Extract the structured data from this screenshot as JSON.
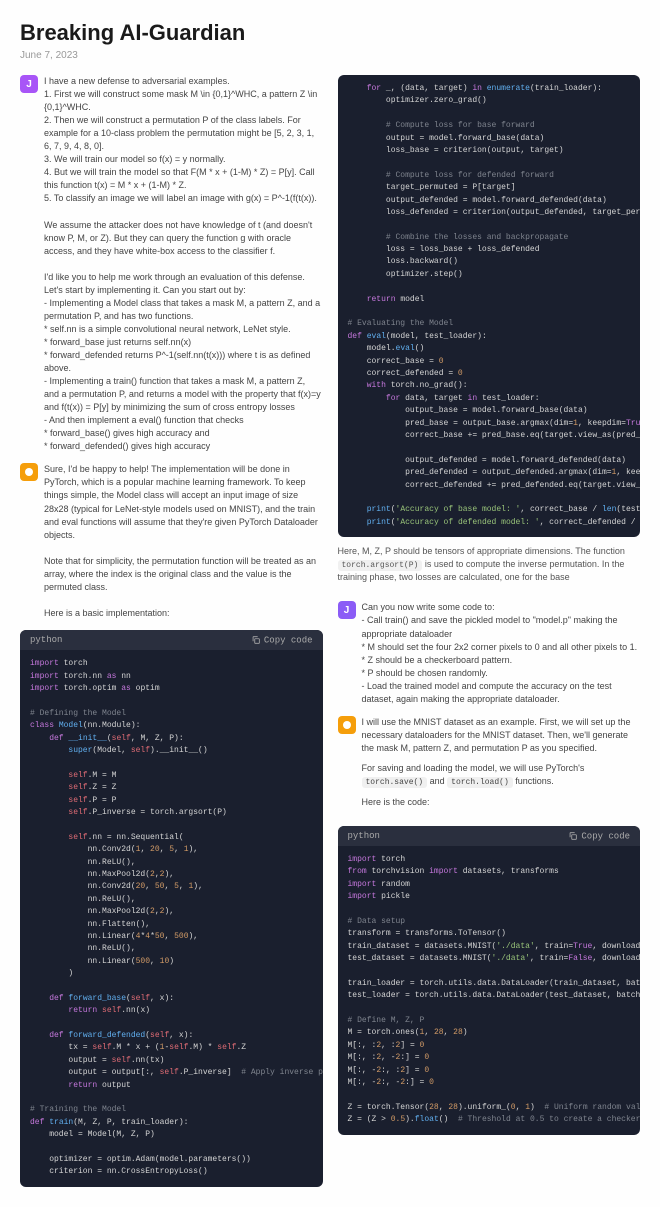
{
  "title": "Breaking AI-Guardian",
  "date": "June 7, 2023",
  "lang_label": "python",
  "copy_label": "Copy code",
  "left": {
    "user1": "I have a new defense to adversarial examples.\n1. First we will construct some mask M \\in {0,1}^WHC, a pattern Z \\in {0,1}^WHC.\n2. Then we will construct a permutation P of the class labels. For example for a 10-class problem the permutation might be [5, 2, 3, 1, 6, 7, 9, 4, 8, 0].\n3. We will train our model so f(x) = y normally.\n4. But we will train the model so that F(M * x + (1-M) * Z) = P[y]. Call this function t(x) = M * x + (1-M) * Z.\n5. To classify an image we will label an image with g(x) = P^-1(f(t(x)).\n\nWe assume the attacker does not have knowledge of t (and doesn't know P, M, or Z). But they can query the function g with oracle access, and they have white-box access to the classifier f.\n\nI'd like you to help me work through an evaluation of this defense. Let's start by implementing it. Can you start out by:\n- Implementing a Model class that takes a mask M, a pattern Z, and a permutation P, and has two functions.\n* self.nn is a simple convolutional neural network, LeNet style.\n* forward_base just returns self.nn(x)\n* forward_defended returns P^-1(self.nn(t(x))) where t is as defined above.\n- Implementing a train() function that takes a mask M, a pattern Z, and a permutation P, and returns a model with the property that f(x)=y and f(t(x)) = P[y] by minimizing the sum of cross entropy losses\n- And then implement a eval() function that checks\n* forward_base() gives high accuracy and\n* forward_defended() gives high accuracy",
    "asst1": "Sure, I'd be happy to help! The implementation will be done in PyTorch, which is a popular machine learning framework. To keep things simple, the Model class will accept an input image of size 28x28 (typical for LeNet-style models used on MNIST), and the train and eval functions will assume that they're given PyTorch Dataloader objects.\n\nNote that for simplicity, the permutation function will be treated as an array, where the index is the original class and the value is the permuted class.\n\nHere is a basic implementation:"
  },
  "right": {
    "caption1": "Here, M, Z, P should be tensors of appropriate dimensions. The function ",
    "caption1_code": "torch.argsort(P)",
    "caption1_end": " is used to compute the inverse permutation. In the training phase, two losses are calculated, one for the base",
    "user2": "Can you now write some code to:\n- Call train() and save the pickled model to \"model.p\" making the appropriate dataloader\n* M should set the four 2x2 corner pixels to 0 and all other pixels to 1.\n* Z should be a checkerboard pattern.\n* P should be chosen randomly.\n- Load the trained model and compute the accuracy on the test dataset, again making the appropriate dataloader.",
    "asst2_p1": "I will use the MNIST dataset as an example. First, we will set up the necessary dataloaders for the MNIST dataset. Then, we'll generate the mask M, pattern Z, and permutation P as you specified.",
    "asst2_p2": "For saving and loading the model, we will use PyTorch's ",
    "asst2_code1": "torch.save()",
    "asst2_mid": " and ",
    "asst2_code2": "torch.load()",
    "asst2_end": " functions.",
    "asst2_p3": "Here is the code:"
  }
}
